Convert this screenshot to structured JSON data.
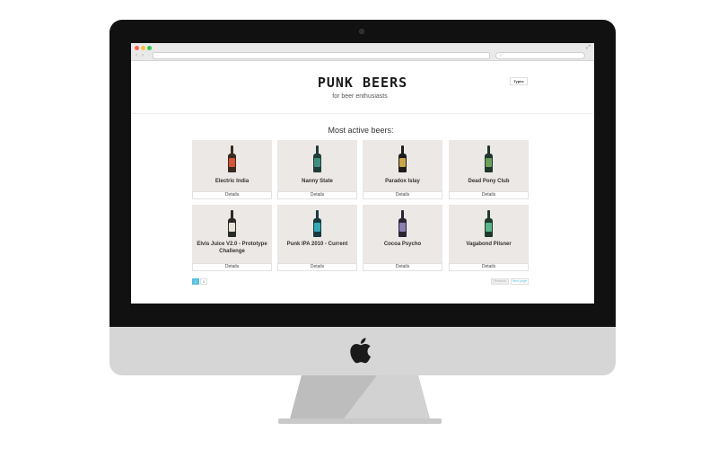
{
  "browser": {
    "url": "‹ ›  •",
    "search_icon": "search-icon",
    "window_controls": [
      "close",
      "minimize",
      "maximize"
    ],
    "url_text": "·",
    "search_text": "○"
  },
  "site": {
    "title": "PUNK BEERS",
    "subtitle": "for beer enthusiasts",
    "types_label": "Types"
  },
  "main": {
    "section_title": "Most active beers:",
    "details_label": "Details",
    "beers": [
      {
        "name": "Electric India",
        "colors": {
          "bottle": "#3b2a1e",
          "label": "#d4553a"
        }
      },
      {
        "name": "Nanny State",
        "colors": {
          "bottle": "#1f3d3a",
          "label": "#3f8f7c"
        }
      },
      {
        "name": "Paradox Islay",
        "colors": {
          "bottle": "#1c1c1c",
          "label": "#c9a64a"
        }
      },
      {
        "name": "Dead Pony Club",
        "colors": {
          "bottle": "#20362c",
          "label": "#6aa15a"
        }
      },
      {
        "name": "Elvis Juice V2.0 - Prototype Challenge",
        "colors": {
          "bottle": "#2a2a2a",
          "label": "#e8e3d8"
        }
      },
      {
        "name": "Punk IPA 2010 - Current",
        "colors": {
          "bottle": "#173a3f",
          "label": "#36a7b7"
        }
      },
      {
        "name": "Cocoa Psycho",
        "colors": {
          "bottle": "#2a2433",
          "label": "#8a7fb0"
        }
      },
      {
        "name": "Vagabond Pilsner",
        "colors": {
          "bottle": "#1f3a2c",
          "label": "#5bb48a"
        }
      }
    ]
  },
  "pagination": {
    "pages": [
      "1",
      "2"
    ],
    "current_page": "1",
    "prev_label": "Previous",
    "next_label": "Next page"
  },
  "colors": {
    "accent": "#5bc0de",
    "card_bg": "#ebe8e6",
    "bezel": "#111111",
    "chin": "#d6d6d6"
  }
}
